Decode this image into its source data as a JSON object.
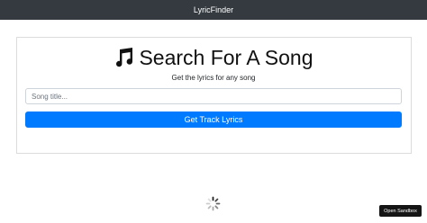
{
  "navbar": {
    "brand": "LyricFinder"
  },
  "search": {
    "title": "Search For A Song",
    "subtitle": "Get the lyrics for any song",
    "placeholder": "Song title...",
    "submit_label": "Get Track Lyrics",
    "title_icon": "music-note-icon"
  },
  "loading": {
    "icon": "spinner-icon"
  },
  "sandbox": {
    "label": "Open Sandbox"
  },
  "colors": {
    "navbar_bg": "#343a40",
    "primary": "#007bff",
    "sandbox_bg": "#151515"
  }
}
